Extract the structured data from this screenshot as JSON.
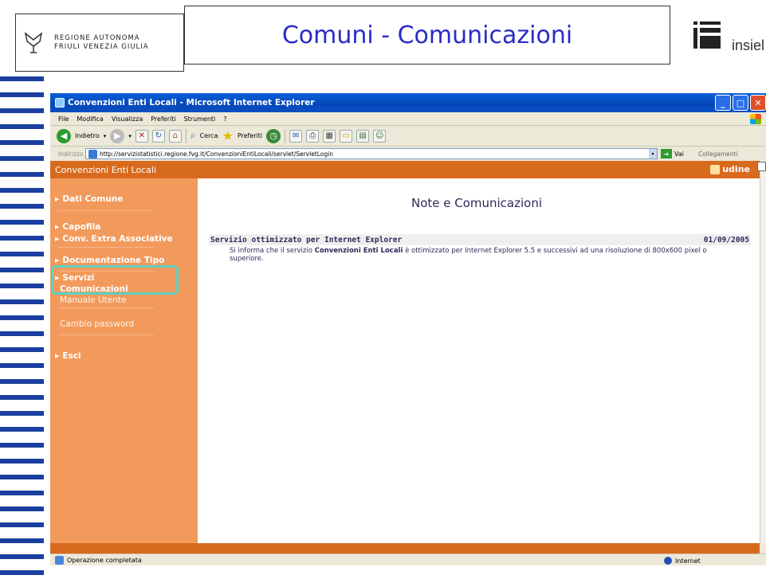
{
  "slide": {
    "logo_line1": "REGIONE AUTONOMA",
    "logo_line2": "FRIULI VENEZIA GIULIA",
    "title": "Comuni - Comunicazioni",
    "company": "insiel"
  },
  "browser": {
    "window_title": "Convenzioni Enti Locali - Microsoft Internet Explorer",
    "menu": [
      "File",
      "Modifica",
      "Visualizza",
      "Preferiti",
      "Strumenti",
      "?"
    ],
    "toolbar": {
      "back": "Indietro",
      "search": "Cerca",
      "favorites": "Preferiti"
    },
    "address_label": "Indirizzo",
    "address_url": "http://servizistatistici.regione.fvg.it/ConvenzioniEntiLocali/servlet/ServletLogin",
    "go_label": "Vai",
    "links_label": "Collegamenti",
    "status_text": "Operazione completata",
    "zone_text": "Internet"
  },
  "app": {
    "header_title": "Convenzioni Enti Locali",
    "user": "udine",
    "nav": {
      "dati_comune": "Dati Comune",
      "capofila": "Capofila",
      "conv_extra": "Conv. Extra Associative",
      "documentazione": "Documentazione Tipo",
      "servizi": "Servizi",
      "comunicazioni": "Comunicazioni",
      "manuale": "Manuale Utente",
      "cambio_password": "Cambio password",
      "esci": "Esci"
    },
    "content": {
      "title": "Note e Comunicazioni",
      "message_subject": "Servizio ottimizzato per Internet Explorer",
      "message_date": "01/09/2005",
      "message_pre": "Si informa che il servizio ",
      "message_bold": "Convenzioni Enti Locali",
      "message_post": " è ottimizzato per Internet Explorer 5.5 e successivi ad una risoluzione di 800x600 pixel o superiore."
    }
  },
  "colors": {
    "accent_orange": "#d86a1e",
    "sidebar_orange": "#f29a5c",
    "title_blue": "#2b2bc8",
    "highlight": "#5ed0c0"
  }
}
